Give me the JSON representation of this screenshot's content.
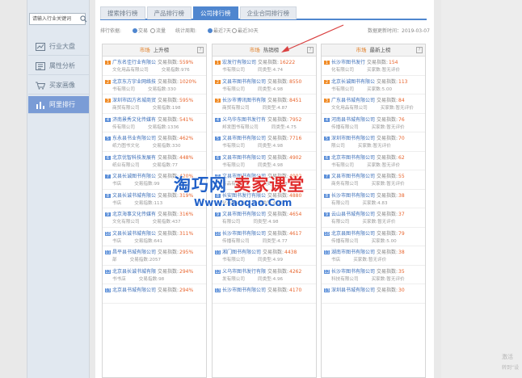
{
  "sidebar": {
    "search_placeholder": "请输入行业关键词",
    "items": [
      {
        "label": "行业大盘",
        "icon": "trend-chart-icon",
        "active": false
      },
      {
        "label": "属性分析",
        "icon": "attribute-icon",
        "active": false
      },
      {
        "label": "买家画像",
        "icon": "cart-icon",
        "active": false
      },
      {
        "label": "阿里排行",
        "icon": "bar-chart-icon",
        "active": true
      }
    ]
  },
  "tabs": [
    {
      "label": "搜索排行榜",
      "active": false
    },
    {
      "label": "产品排行榜",
      "active": false
    },
    {
      "label": "公司排行榜",
      "active": true
    },
    {
      "label": "企业合同排行榜",
      "active": false
    }
  ],
  "filters": {
    "rank_label": "排行依据:",
    "option_trade": "交易",
    "option_traffic": "流量",
    "period_label": "统计周期:",
    "option_7": "最近7天",
    "option_30": "最近30天",
    "update_label": "数据更新时间：",
    "update_date": "2019-03-07"
  },
  "columns": [
    {
      "tag": "市场",
      "title": "上升榜",
      "rows": [
        {
          "rank": "1",
          "name": "广东名佳行业有限公",
          "metric": "交易指数:",
          "value": "559%",
          "sub": "文化用品有限公司",
          "sub_label": "交易指数:",
          "sub_value": "976"
        },
        {
          "rank": "2",
          "name": "北京东方宇业网络技",
          "metric": "交易指数:",
          "value": "1020%",
          "sub": "书有限公司",
          "sub_label": "交易指数:",
          "sub_value": "330"
        },
        {
          "rank": "3",
          "name": "深圳市四方名城商贸",
          "metric": "交易指数:",
          "value": "595%",
          "sub": "商贸有限公司",
          "sub_label": "交易指数:",
          "sub_value": "198"
        },
        {
          "rank": "4",
          "name": "济南景秀文化传媒有",
          "metric": "交易指数:",
          "value": "541%",
          "sub": "传有限公司",
          "sub_label": "交易指数:",
          "sub_value": "1336"
        },
        {
          "rank": "5",
          "name": "东永县书业有限公司",
          "metric": "交易指数:",
          "value": "462%",
          "sub": "纸力图书文化",
          "sub_label": "交易指数:",
          "sub_value": "330"
        },
        {
          "rank": "6",
          "name": "北京优智科技发展有",
          "metric": "交易指数:",
          "value": "448%",
          "sub": "纸业有限公司",
          "sub_label": "交易指数:",
          "sub_value": "77"
        },
        {
          "rank": "7",
          "name": "文县长诚图书有限公",
          "metric": "交易指数:",
          "value": "420%",
          "sub": "书店",
          "sub_label": "交易指数:",
          "sub_value": "99"
        },
        {
          "rank": "8",
          "name": "文县长诚书城有限公",
          "metric": "交易指数:",
          "value": "319%",
          "sub": "书店",
          "sub_label": "交易指数:",
          "sub_value": "113"
        },
        {
          "rank": "9",
          "name": "北京海事文化传媒有",
          "metric": "交易指数:",
          "value": "316%",
          "sub": "文化有限公司",
          "sub_label": "交易指数:",
          "sub_value": "437"
        },
        {
          "rank": "10",
          "name": "文县长诚书城有限公",
          "metric": "交易指数:",
          "value": "311%",
          "sub": "书店",
          "sub_label": "交易指数:",
          "sub_value": "641"
        },
        {
          "rank": "11",
          "name": "昌平县书城有限公司",
          "metric": "交易指数:",
          "value": "295%",
          "sub": "部",
          "sub_label": "交易指数:",
          "sub_value": "2057"
        },
        {
          "rank": "12",
          "name": "北京县长诚书城有限",
          "metric": "交易指数:",
          "value": "294%",
          "sub": "书书店",
          "sub_label": "交易指数:",
          "sub_value": "98"
        },
        {
          "rank": "13",
          "name": "北京县书城有限公司",
          "metric": "交易指数:",
          "value": "294%",
          "sub": "",
          "sub_label": "",
          "sub_value": ""
        }
      ]
    },
    {
      "tag": "市场",
      "title": "热销榜",
      "rows": [
        {
          "rank": "1",
          "name": "宏发行有限公司",
          "metric": "交易指数:",
          "value": "16222",
          "sub": "书有限公司",
          "sub_label": "同类型:",
          "sub_value": "4.74"
        },
        {
          "rank": "2",
          "name": "文县市图书有限公司",
          "metric": "交易指数:",
          "value": "8550",
          "sub": "书有限公司",
          "sub_label": "同类型:",
          "sub_value": "4.98"
        },
        {
          "rank": "3",
          "name": "长沙市博讯图书有限",
          "metric": "交易指数:",
          "value": "8451",
          "sub": "商贸有限公司",
          "sub_label": "同类型:",
          "sub_value": "4.87"
        },
        {
          "rank": "4",
          "name": "义乌华东图书发行有",
          "metric": "交易指数:",
          "value": "7952",
          "sub": "邦发图书有限公司",
          "sub_label": "同类型:",
          "sub_value": "4.75"
        },
        {
          "rank": "5",
          "name": "文县市图书有限公司",
          "metric": "交易指数:",
          "value": "7716",
          "sub": "书有限公司",
          "sub_label": "同类型:",
          "sub_value": "4.98"
        },
        {
          "rank": "6",
          "name": "文县市图书有限公司",
          "metric": "交易指数:",
          "value": "4902",
          "sub": "书有限公司",
          "sub_label": "同类型:",
          "sub_value": "4.98"
        },
        {
          "rank": "7",
          "name": "文县市图书有限公司",
          "metric": "交易指数:",
          "value": "4902",
          "sub": "商品有限公司",
          "sub_label": "同类型:",
          "sub_value": "4.98"
        },
        {
          "rank": "8",
          "name": "长安图书发行有限公",
          "metric": "交易指数:",
          "value": "4880",
          "sub": "化有限公司",
          "sub_label": "同类型:",
          "sub_value": "4.96"
        },
        {
          "rank": "9",
          "name": "文县市图书有限公司",
          "metric": "交易指数:",
          "value": "4654",
          "sub": "有限公司",
          "sub_label": "同类型:",
          "sub_value": "4.98"
        },
        {
          "rank": "10",
          "name": "长沙市图书有限公司",
          "metric": "交易指数:",
          "value": "4617",
          "sub": "传播有限公司",
          "sub_label": "同类型:",
          "sub_value": "4.77"
        },
        {
          "rank": "11",
          "name": "湘门图书有限公司",
          "metric": "交易指数:",
          "value": "4438",
          "sub": "书有限公司",
          "sub_label": "同类型:",
          "sub_value": "4.99"
        },
        {
          "rank": "12",
          "name": "义乌市图书发行有限",
          "metric": "交易指数:",
          "value": "4262",
          "sub": "发有限公司",
          "sub_label": "同类型:",
          "sub_value": "4.96"
        },
        {
          "rank": "13",
          "name": "长沙市图书有限公司",
          "metric": "交易指数:",
          "value": "4170",
          "sub": "",
          "sub_label": "",
          "sub_value": ""
        }
      ]
    },
    {
      "tag": "市场",
      "title": "最新上榜",
      "rows": [
        {
          "rank": "1",
          "name": "长沙市图书发行",
          "metric": "交易指数:",
          "value": "154",
          "sub": "化有限公司",
          "sub_label": "买家数:",
          "sub_value": "暂无评价"
        },
        {
          "rank": "2",
          "name": "北京长诚图书有限公",
          "metric": "交易指数:",
          "value": "113",
          "sub": "书有限公司",
          "sub_label": "买家数:",
          "sub_value": "5.00"
        },
        {
          "rank": "3",
          "name": "广东县书城有限公司",
          "metric": "交易指数:",
          "value": "84",
          "sub": "文化用品有限公司",
          "sub_label": "买家数:",
          "sub_value": "暂无评价"
        },
        {
          "rank": "4",
          "name": "河南县书城有限公司",
          "metric": "交易指数:",
          "value": "76",
          "sub": "传播有限公司",
          "sub_label": "买家数:",
          "sub_value": "暂无评价"
        },
        {
          "rank": "5",
          "name": "深圳市图书有限公司",
          "metric": "交易指数:",
          "value": "70",
          "sub": "限公司",
          "sub_label": "买家数:",
          "sub_value": "暂无评价"
        },
        {
          "rank": "6",
          "name": "北京市图书有限公司",
          "metric": "交易指数:",
          "value": "62",
          "sub": "书有限公司",
          "sub_label": "买家数:",
          "sub_value": "暂无评价"
        },
        {
          "rank": "7",
          "name": "文县市图书有限公司",
          "metric": "交易指数:",
          "value": "55",
          "sub": "商务有限公司",
          "sub_label": "买家数:",
          "sub_value": "暂无评价"
        },
        {
          "rank": "8",
          "name": "长沙市图书有限公司",
          "metric": "交易指数:",
          "value": "38",
          "sub": "有限公司",
          "sub_label": "买家数:",
          "sub_value": "4.83"
        },
        {
          "rank": "9",
          "name": "云山县书城有限公司",
          "metric": "交易指数:",
          "value": "37",
          "sub": "有限公司",
          "sub_label": "买家数:",
          "sub_value": "暂无评价"
        },
        {
          "rank": "10",
          "name": "北京县图书有限公司",
          "metric": "交易指数:",
          "value": "79",
          "sub": "传播有限公司",
          "sub_label": "买家数:",
          "sub_value": "5.00"
        },
        {
          "rank": "11",
          "name": "湖南市图书有限公司",
          "metric": "交易指数:",
          "value": "38",
          "sub": "书店",
          "sub_label": "买家数:",
          "sub_value": "暂无评价"
        },
        {
          "rank": "12",
          "name": "长沙市图书有限公司",
          "metric": "交易指数:",
          "value": "35",
          "sub": "科技有限公司",
          "sub_label": "买家数:",
          "sub_value": "暂无评价"
        },
        {
          "rank": "13",
          "name": "深圳县书城有限公司",
          "metric": "交易指数:",
          "value": "30",
          "sub": "",
          "sub_label": "",
          "sub_value": ""
        }
      ]
    }
  ],
  "watermark": {
    "line1_blue": "淘巧网",
    "line1_red": "卖家课堂",
    "line2_blue": "Www.Taoqao.Com",
    "activate": "激活",
    "activate_sub": "转到“设"
  }
}
